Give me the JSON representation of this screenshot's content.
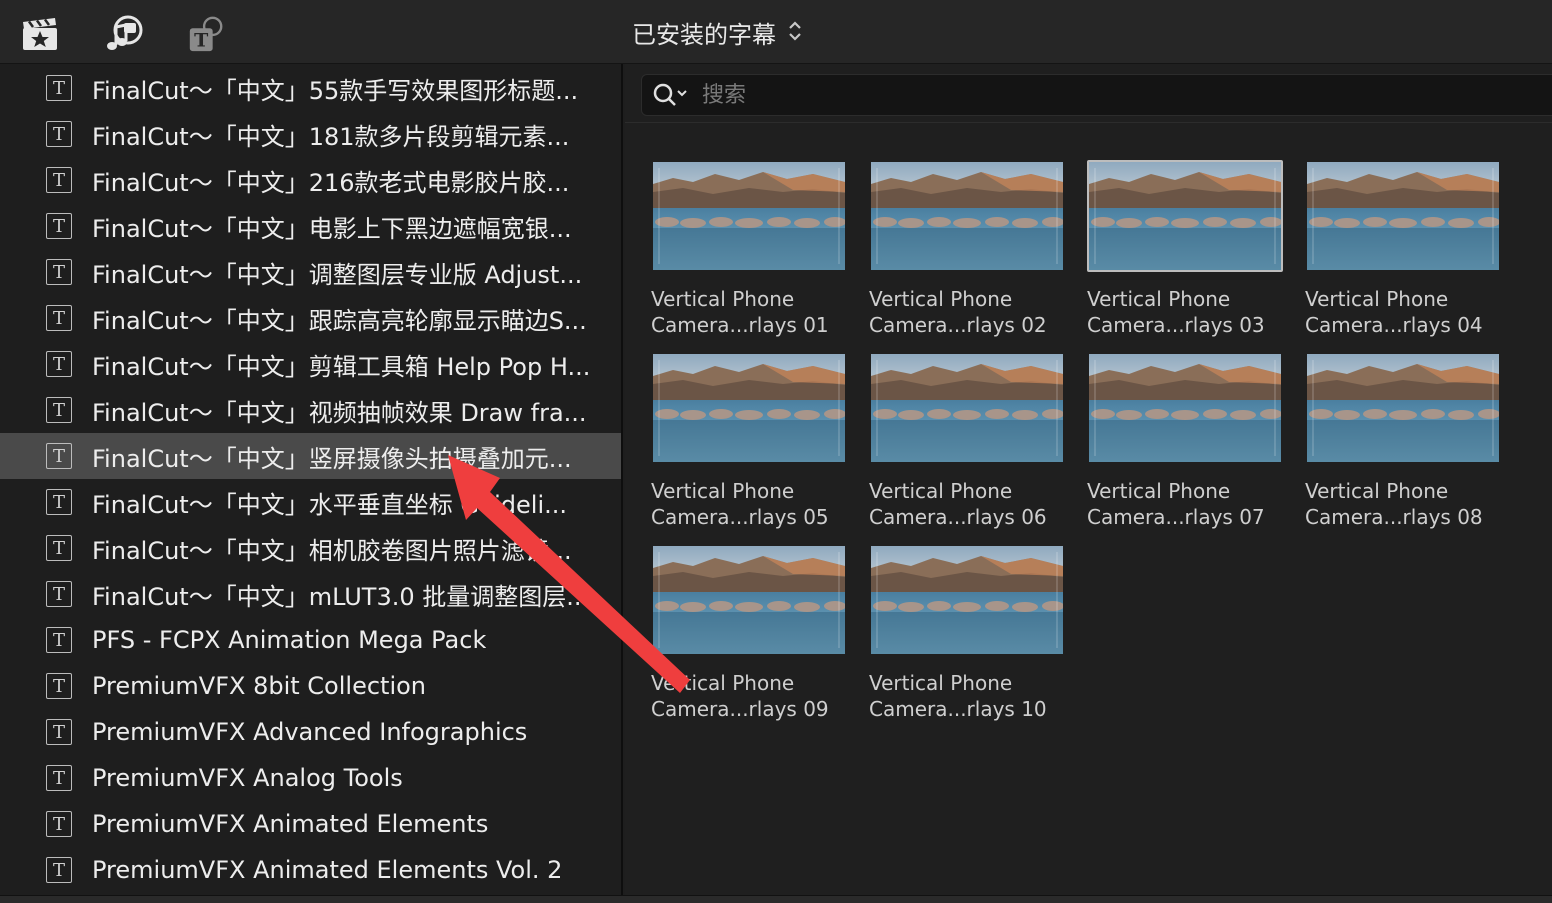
{
  "toolbar": {
    "icons": [
      "clapper-star-icon",
      "music-camera-icon",
      "titles-icon"
    ],
    "browser_title": "已安装的字幕",
    "browser_title_chevron": "⌃⌄"
  },
  "sidebar": {
    "items": [
      {
        "label": "FinalCut～「中文」55款手写效果图形标题..."
      },
      {
        "label": "FinalCut～「中文」181款多片段剪辑元素..."
      },
      {
        "label": "FinalCut～「中文」216款老式电影胶片胶..."
      },
      {
        "label": "FinalCut～「中文」电影上下黑边遮幅宽银..."
      },
      {
        "label": "FinalCut～「中文」调整图层专业版 Adjust..."
      },
      {
        "label": "FinalCut～「中文」跟踪高亮轮廓显示瞄边S..."
      },
      {
        "label": "FinalCut～「中文」剪辑工具箱 Help Pop H..."
      },
      {
        "label": "FinalCut～「中文」视频抽帧效果 Draw fra..."
      },
      {
        "label": "FinalCut～「中文」竖屏摄像头拍摄叠加元...",
        "selected": true
      },
      {
        "label": "FinalCut～「中文」水平垂直坐标 Guideli..."
      },
      {
        "label": "FinalCut～「中文」相机胶卷图片照片滤镜..."
      },
      {
        "label": "FinalCut～「中文」mLUT3.0 批量调整图层..."
      },
      {
        "label": "PFS - FCPX Animation Mega Pack"
      },
      {
        "label": "PremiumVFX 8bit Collection"
      },
      {
        "label": "PremiumVFX Advanced Infographics"
      },
      {
        "label": "PremiumVFX Analog Tools"
      },
      {
        "label": "PremiumVFX Animated Elements"
      },
      {
        "label": "PremiumVFX Animated Elements Vol. 2"
      }
    ],
    "item_icon": "T"
  },
  "search": {
    "placeholder": "搜索",
    "value": ""
  },
  "thumbnails": [
    {
      "line1": "Vertical Phone",
      "line2": "Camera...rlays 01"
    },
    {
      "line1": "Vertical Phone",
      "line2": "Camera...rlays 02"
    },
    {
      "line1": "Vertical Phone",
      "line2": "Camera...rlays 03",
      "selected": true
    },
    {
      "line1": "Vertical Phone",
      "line2": "Camera...rlays 04"
    },
    {
      "line1": "Vertical Phone",
      "line2": "Camera...rlays 05"
    },
    {
      "line1": "Vertical Phone",
      "line2": "Camera...rlays 06"
    },
    {
      "line1": "Vertical Phone",
      "line2": "Camera...rlays 07"
    },
    {
      "line1": "Vertical Phone",
      "line2": "Camera...rlays 08"
    },
    {
      "line1": "Vertical Phone",
      "line2": "Camera...rlays 09"
    },
    {
      "line1": "Vertical Phone",
      "line2": "Camera...rlays 10"
    }
  ],
  "colors": {
    "selected_row": "#4a4a4a",
    "arrow": "#ef3e3e"
  }
}
